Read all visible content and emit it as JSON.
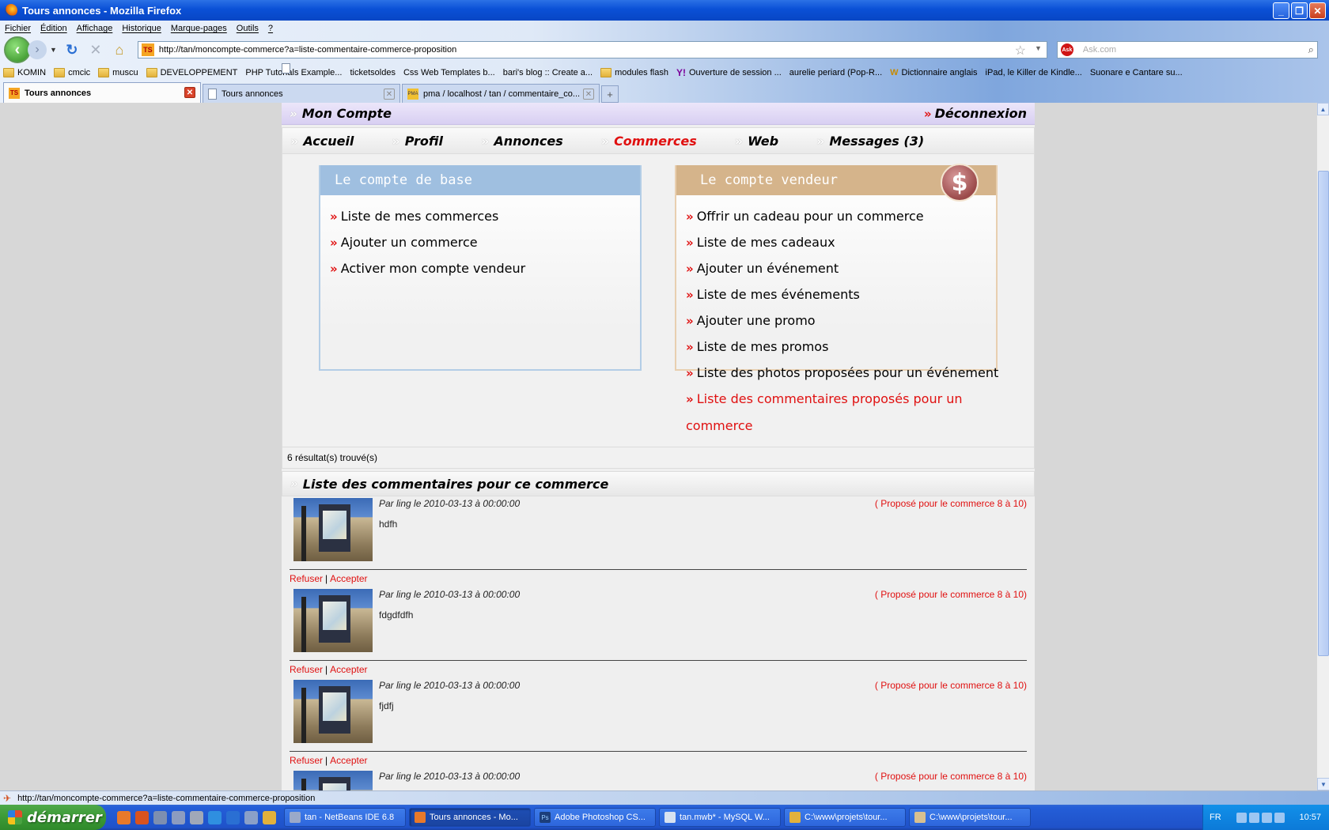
{
  "window": {
    "title": "Tours annonces - Mozilla Firefox"
  },
  "menu": [
    "Fichier",
    "Édition",
    "Affichage",
    "Historique",
    "Marque-pages",
    "Outils",
    "?"
  ],
  "address": {
    "url": "http://tan/moncompte-commerce?a=liste-commentaire-commerce-proposition"
  },
  "search": {
    "placeholder": "Ask.com"
  },
  "bookmarks": [
    {
      "label": "KOMIN",
      "icon": "folder-icon"
    },
    {
      "label": "cmcic",
      "icon": "folder-icon"
    },
    {
      "label": "muscu",
      "icon": "folder-icon"
    },
    {
      "label": "DEVELOPPEMENT",
      "icon": "folder-icon"
    },
    {
      "label": "PHP Tutorials Example...",
      "icon": "page-icon"
    },
    {
      "label": "ticketsoldes",
      "icon": "page-icon"
    },
    {
      "label": "Css Web Templates b...",
      "icon": "page-icon"
    },
    {
      "label": "bari's blog :: Create a...",
      "icon": "page-icon"
    },
    {
      "label": "modules flash",
      "icon": "folder-icon"
    },
    {
      "label": "Ouverture de session ...",
      "icon": "yahoo-icon"
    },
    {
      "label": "aurelie periard (Pop-R...",
      "icon": "page-icon"
    },
    {
      "label": "Dictionnaire anglais",
      "icon": "wr-icon"
    },
    {
      "label": "iPad, le Killer de Kindle...",
      "icon": "page-icon"
    },
    {
      "label": "Suonare e Cantare su...",
      "icon": "page-icon"
    }
  ],
  "tabs": [
    {
      "label": "Tours annonces",
      "active": true
    },
    {
      "label": "Tours annonces",
      "active": false
    },
    {
      "label": "pma / localhost / tan / commentaire_co...",
      "active": false
    }
  ],
  "site": {
    "account_title": "Mon Compte",
    "logout": "Déconnexion",
    "nav": [
      {
        "label": "Accueil",
        "current": false
      },
      {
        "label": "Profil",
        "current": false
      },
      {
        "label": "Annonces",
        "current": false
      },
      {
        "label": "Commerces",
        "current": true
      },
      {
        "label": "Web",
        "current": false
      },
      {
        "label": "Messages (3)",
        "current": false
      }
    ],
    "base_panel": {
      "title": "Le compte de base",
      "links": [
        "Liste de mes commerces",
        "Ajouter un commerce",
        "Activer mon compte vendeur"
      ]
    },
    "vendor_panel": {
      "title": "Le compte vendeur",
      "dollar": "$",
      "links": [
        "Offrir un cadeau pour un commerce",
        "Liste de mes cadeaux",
        "Ajouter un événement",
        "Liste de mes événements",
        "Ajouter une promo",
        "Liste de mes promos",
        "Liste des photos proposées pour un événement",
        "Liste des commentaires proposés pour un commerce"
      ]
    },
    "results": "6 résultat(s) trouvé(s)",
    "comments_title": "Liste des commentaires pour ce commerce",
    "refuse": "Refuser",
    "accept": "Accepter",
    "pipe": "|",
    "comments": [
      {
        "meta": "Par ling le 2010-03-13 à 00:00:00",
        "proposed": "( Proposé pour le commerce 8 à 10)",
        "text": "hdfh"
      },
      {
        "meta": "Par ling le 2010-03-13 à 00:00:00",
        "proposed": "( Proposé pour le commerce 8 à 10)",
        "text": "fdgdfdfh"
      },
      {
        "meta": "Par ling le 2010-03-13 à 00:00:00",
        "proposed": "( Proposé pour le commerce 8 à 10)",
        "text": "fjdfj"
      },
      {
        "meta": "Par ling le 2010-03-13 à 00:00:00",
        "proposed": "( Proposé pour le commerce 8 à 10)",
        "text": ""
      }
    ]
  },
  "status": {
    "text": "http://tan/moncompte-commerce?a=liste-commentaire-commerce-proposition"
  },
  "taskbar": {
    "start": "démarrer",
    "items": [
      {
        "label": "tan - NetBeans IDE 6.8",
        "active": false
      },
      {
        "label": "Tours annonces - Mo...",
        "active": true
      },
      {
        "label": "Adobe Photoshop CS...",
        "active": false
      },
      {
        "label": "tan.mwb* - MySQL W...",
        "active": false
      },
      {
        "label": "C:\\www\\projets\\tour...",
        "active": false
      },
      {
        "label": "C:\\www\\projets\\tour...",
        "active": false
      }
    ],
    "lang": "FR",
    "clock": "10:57"
  },
  "colors": {
    "accent_red": "#e01010",
    "base_panel": "#9fbfe0",
    "vendor_panel": "#d5b48b"
  }
}
